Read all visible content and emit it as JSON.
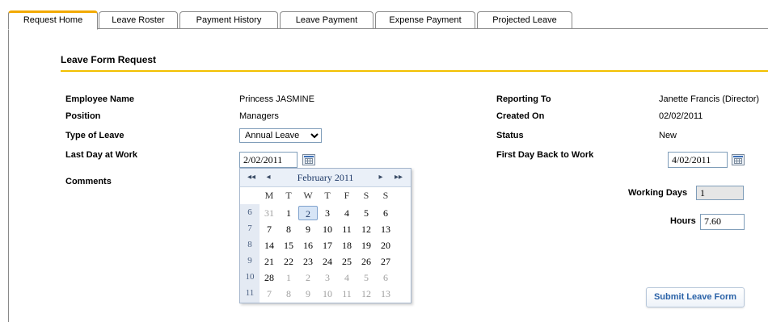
{
  "tabs": [
    {
      "label": "Request Home",
      "active": true
    },
    {
      "label": "Leave Roster",
      "active": false
    },
    {
      "label": "Payment History",
      "active": false
    },
    {
      "label": "Leave Payment",
      "active": false
    },
    {
      "label": "Expense Payment",
      "active": false
    },
    {
      "label": "Projected Leave",
      "active": false
    }
  ],
  "form": {
    "title": "Leave Form Request",
    "employee_name_label": "Employee Name",
    "employee_name": "Princess JASMINE",
    "position_label": "Position",
    "position": "Managers",
    "type_of_leave_label": "Type of Leave",
    "type_of_leave": "Annual Leave",
    "last_day_label": "Last Day at Work",
    "last_day": "2/02/2011",
    "comments_label": "Comments",
    "reporting_to_label": "Reporting To",
    "reporting_to": "Janette Francis (Director)",
    "created_on_label": "Created On",
    "created_on": "02/02/2011",
    "status_label": "Status",
    "status": "New",
    "first_day_back_label": "First Day Back to Work",
    "first_day_back": "4/02/2011",
    "working_days_label": "Working Days",
    "working_days": "1",
    "hours_label": "Hours",
    "hours": "7.60",
    "submit_label": "Submit Leave Form"
  },
  "calendar": {
    "prev_year": "◂◂",
    "prev_month": "◂",
    "title": "February 2011",
    "next_month": "▸",
    "next_year": "▸▸",
    "weekdays": [
      "M",
      "T",
      "W",
      "T",
      "F",
      "S",
      "S"
    ],
    "weeks": [
      {
        "week": "6",
        "days": [
          {
            "d": "31",
            "other": true
          },
          {
            "d": "1"
          },
          {
            "d": "2",
            "selected": true
          },
          {
            "d": "3"
          },
          {
            "d": "4"
          },
          {
            "d": "5"
          },
          {
            "d": "6"
          }
        ]
      },
      {
        "week": "7",
        "days": [
          {
            "d": "7"
          },
          {
            "d": "8"
          },
          {
            "d": "9"
          },
          {
            "d": "10"
          },
          {
            "d": "11"
          },
          {
            "d": "12"
          },
          {
            "d": "13"
          }
        ]
      },
      {
        "week": "8",
        "days": [
          {
            "d": "14"
          },
          {
            "d": "15"
          },
          {
            "d": "16"
          },
          {
            "d": "17"
          },
          {
            "d": "18"
          },
          {
            "d": "19"
          },
          {
            "d": "20"
          }
        ]
      },
      {
        "week": "9",
        "days": [
          {
            "d": "21"
          },
          {
            "d": "22"
          },
          {
            "d": "23"
          },
          {
            "d": "24"
          },
          {
            "d": "25"
          },
          {
            "d": "26"
          },
          {
            "d": "27"
          }
        ]
      },
      {
        "week": "10",
        "days": [
          {
            "d": "28"
          },
          {
            "d": "1",
            "other": true
          },
          {
            "d": "2",
            "other": true
          },
          {
            "d": "3",
            "other": true
          },
          {
            "d": "4",
            "other": true
          },
          {
            "d": "5",
            "other": true
          },
          {
            "d": "6",
            "other": true
          }
        ]
      },
      {
        "week": "11",
        "days": [
          {
            "d": "7",
            "other": true
          },
          {
            "d": "8",
            "other": true
          },
          {
            "d": "9",
            "other": true
          },
          {
            "d": "10",
            "other": true
          },
          {
            "d": "11",
            "other": true
          },
          {
            "d": "12",
            "other": true
          },
          {
            "d": "13",
            "other": true
          }
        ]
      }
    ]
  },
  "colors": {
    "active_tab_accent": "#f2a900",
    "rule": "#f2c000",
    "button_text": "#2b63a8",
    "calendar_header": "#eaf0f8"
  }
}
